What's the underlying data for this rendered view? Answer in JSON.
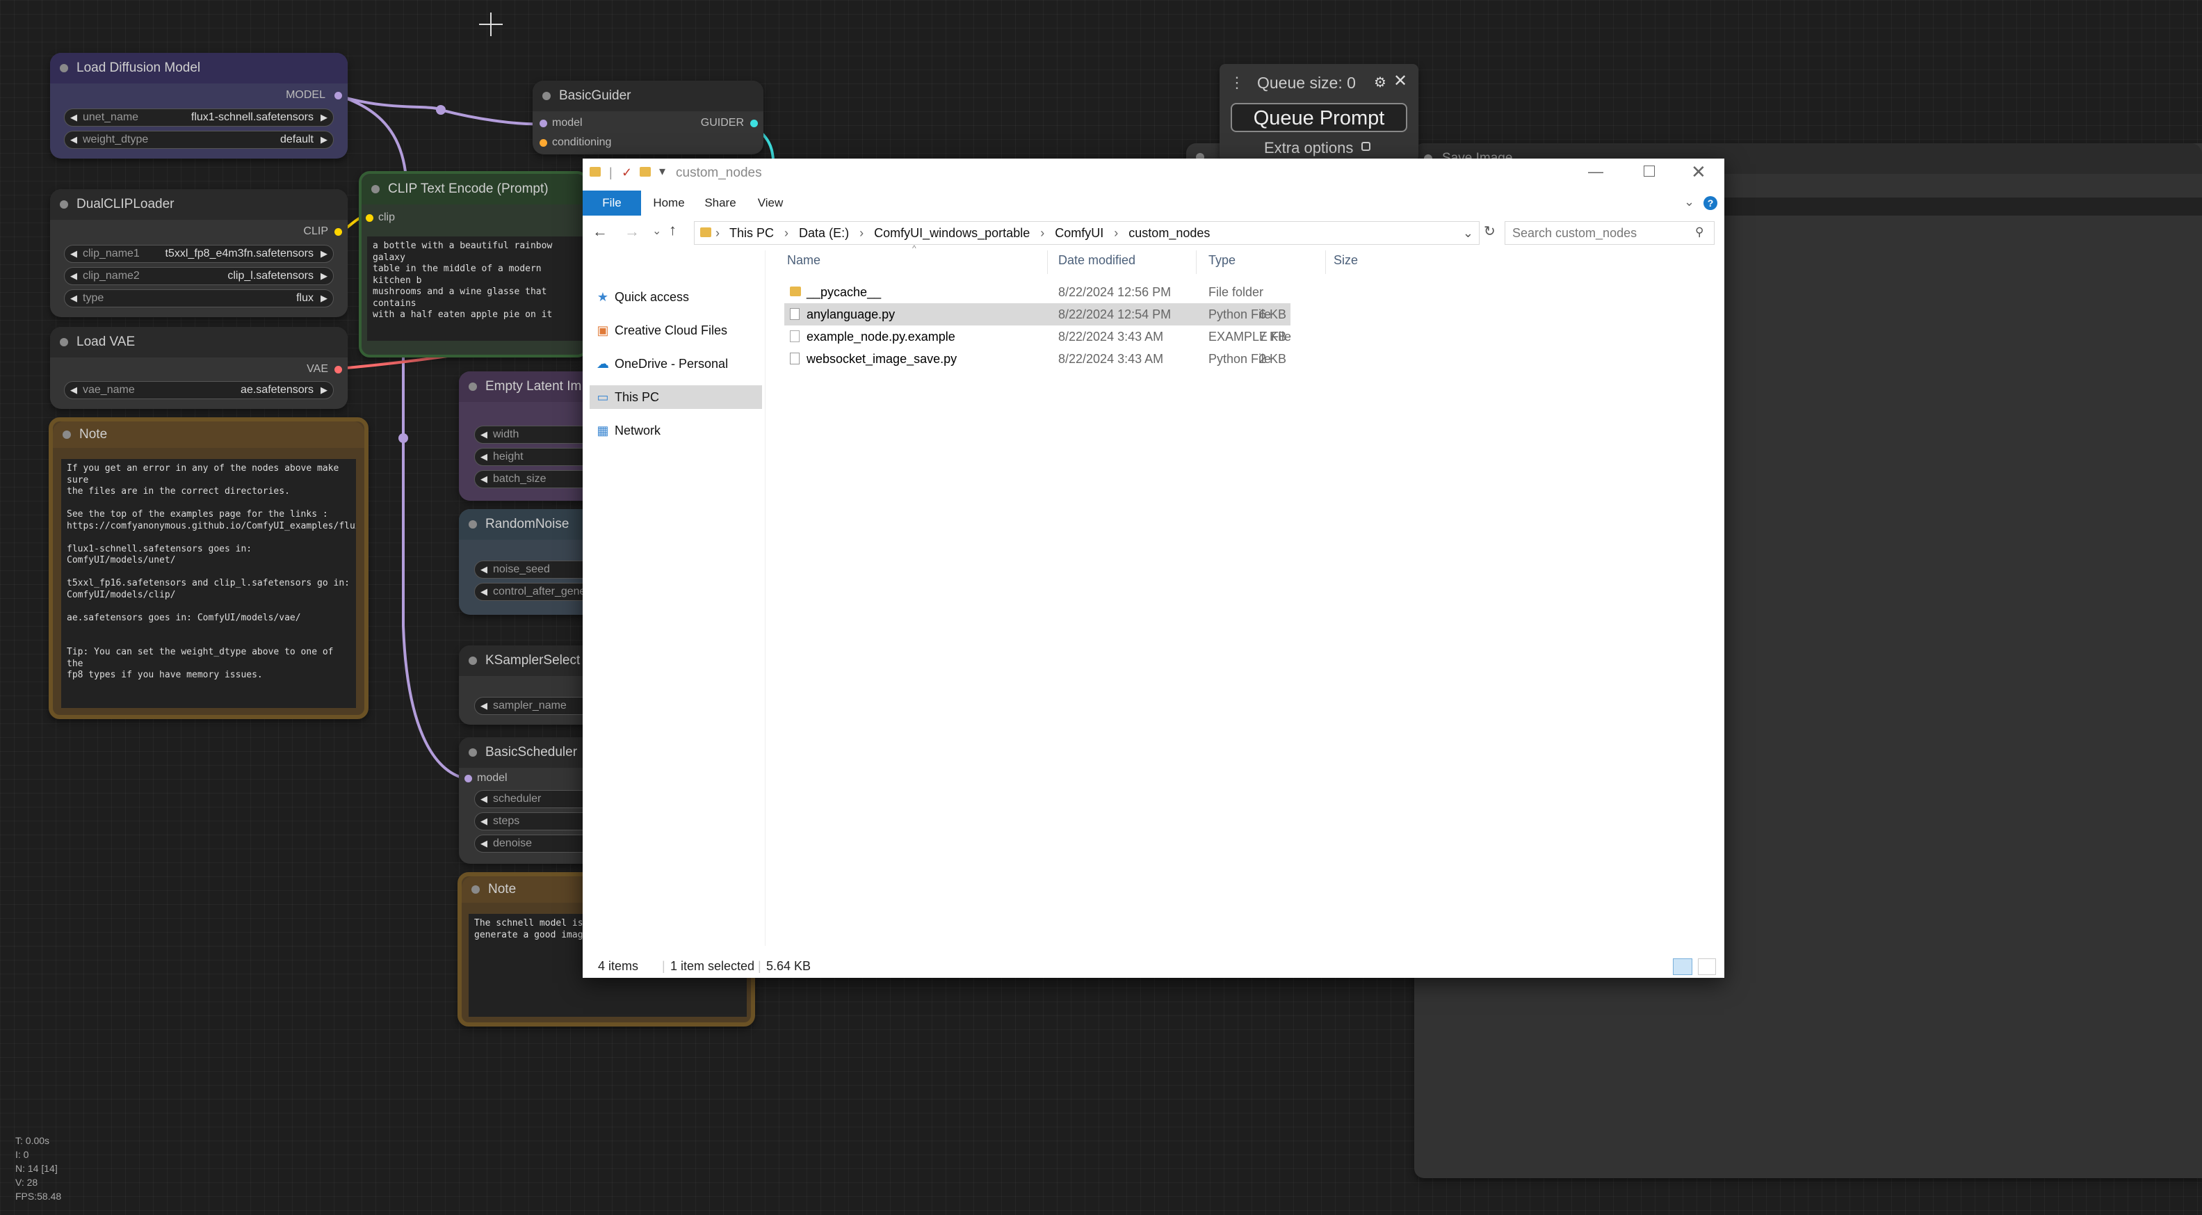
{
  "canvas": {
    "accent_colors": {
      "model_link": "#b39ddb",
      "vae_link": "#ff6e6e",
      "guider_link": "#3ee0e0",
      "clip_port": "#ffd500"
    }
  },
  "nodes": {
    "load_diffusion": {
      "title": "Load Diffusion Model",
      "output": "MODEL",
      "widgets": [
        {
          "label": "unet_name",
          "value": "flux1-schnell.safetensors"
        },
        {
          "label": "weight_dtype",
          "value": "default"
        }
      ]
    },
    "dual_clip": {
      "title": "DualCLIPLoader",
      "output": "CLIP",
      "widgets": [
        {
          "label": "clip_name1",
          "value": "t5xxl_fp8_e4m3fn.safetensors"
        },
        {
          "label": "clip_name2",
          "value": "clip_l.safetensors"
        },
        {
          "label": "type",
          "value": "flux"
        }
      ]
    },
    "load_vae": {
      "title": "Load VAE",
      "output": "VAE",
      "widgets": [
        {
          "label": "vae_name",
          "value": "ae.safetensors"
        }
      ]
    },
    "note1": {
      "title": "Note",
      "text": "If you get an error in any of the nodes above make sure\nthe files are in the correct directories.\n\nSee the top of the examples page for the links :\nhttps://comfyanonymous.github.io/ComfyUI_examples/flux/\n\nflux1-schnell.safetensors goes in: ComfyUI/models/unet/\n\nt5xxl_fp16.safetensors and clip_l.safetensors go in:\nComfyUI/models/clip/\n\nae.safetensors goes in: ComfyUI/models/vae/\n\n\nTip: You can set the weight_dtype above to one of the\nfp8 types if you have memory issues."
    },
    "clip_text": {
      "title": "CLIP Text Encode (Prompt)",
      "input": "clip",
      "text": "a bottle with a beautiful rainbow galaxy\ntable in the middle of a modern kitchen b\nmushrooms and a wine glasse that contains\nwith a half eaten apple pie on it"
    },
    "basic_guider": {
      "title": "BasicGuider",
      "inputs": [
        "model",
        "conditioning"
      ],
      "output": "GUIDER"
    },
    "empty_latent": {
      "title": "Empty Latent Im",
      "widgets": [
        "width",
        "height",
        "batch_size"
      ]
    },
    "random_noise": {
      "title": "RandomNoise",
      "widgets": [
        "noise_seed",
        "control_after_gene"
      ]
    },
    "ksampler_select": {
      "title": "KSamplerSelect",
      "widgets": [
        "sampler_name"
      ]
    },
    "basic_scheduler": {
      "title": "BasicScheduler",
      "input": "model",
      "widgets": [
        "scheduler",
        "steps",
        "denoise"
      ]
    },
    "note2": {
      "title": "Note",
      "text": "The schnell model is a\ngenerate a good image"
    },
    "save_image": {
      "title": "Save Image"
    }
  },
  "queue": {
    "title": "Queue size: 0",
    "button": "Queue Prompt",
    "extra": "Extra options"
  },
  "explorer": {
    "title": "custom_nodes",
    "tabs": [
      "File",
      "Home",
      "Share",
      "View"
    ],
    "breadcrumb": [
      "This PC",
      "Data (E:)",
      "ComfyUI_windows_portable",
      "ComfyUI",
      "custom_nodes"
    ],
    "search_placeholder": "Search custom_nodes",
    "nav": [
      "Quick access",
      "Creative Cloud Files",
      "OneDrive - Personal",
      "This PC",
      "Network"
    ],
    "columns": [
      "Name",
      "Date modified",
      "Type",
      "Size"
    ],
    "files": [
      {
        "name": "__pycache__",
        "date": "8/22/2024 12:56 PM",
        "type": "File folder",
        "size": ""
      },
      {
        "name": "anylanguage.py",
        "date": "8/22/2024 12:54 PM",
        "type": "Python File",
        "size": "6 KB"
      },
      {
        "name": "example_node.py.example",
        "date": "8/22/2024 3:43 AM",
        "type": "EXAMPLE File",
        "size": "7 KB"
      },
      {
        "name": "websocket_image_save.py",
        "date": "8/22/2024 3:43 AM",
        "type": "Python File",
        "size": "2 KB"
      }
    ],
    "status": {
      "items": "4 items",
      "selected": "1 item selected",
      "size": "5.64 KB"
    }
  },
  "stats": [
    "T: 0.00s",
    "I: 0",
    "N: 14 [14]",
    "V: 28",
    "FPS:58.48"
  ]
}
